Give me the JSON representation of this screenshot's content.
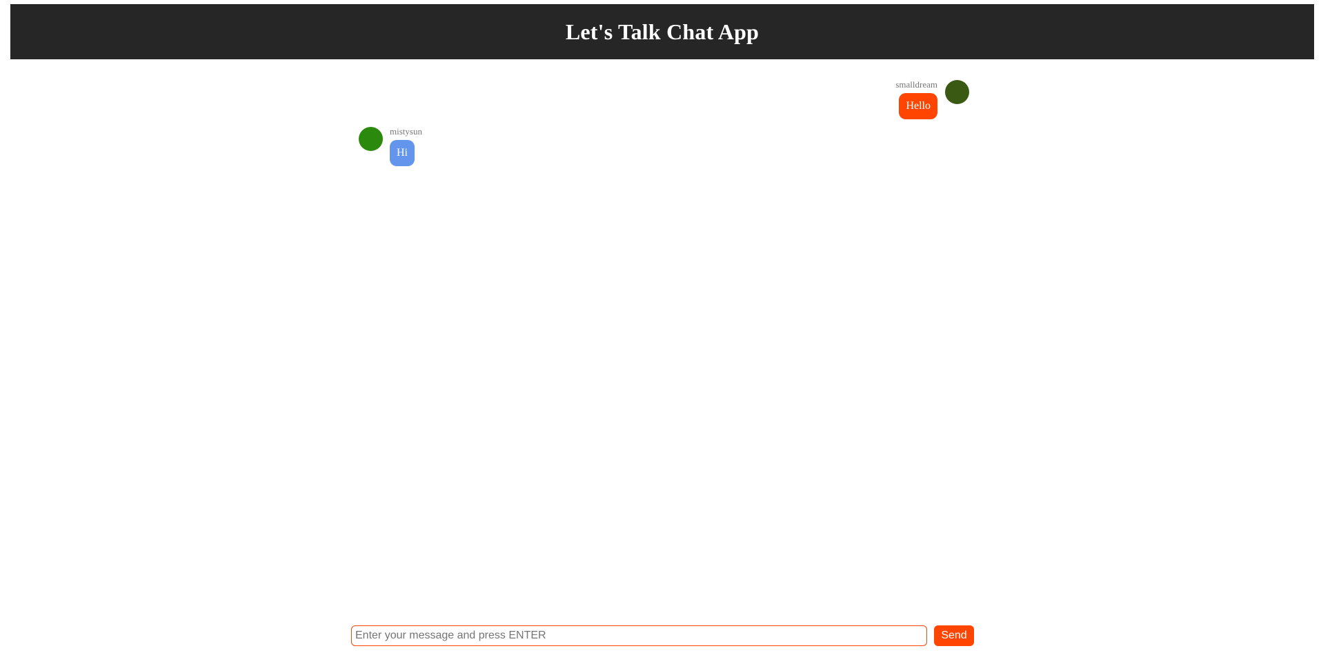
{
  "header": {
    "title": "Let's Talk Chat App"
  },
  "messages": [
    {
      "username": "smalldream",
      "text": "Hello",
      "side": "right",
      "avatar_color": "#3a5a13",
      "bubble_color": "#ff4500"
    },
    {
      "username": "mistysun",
      "text": "Hi",
      "side": "left",
      "avatar_color": "#2b8a0d",
      "bubble_color": "#6495ed"
    }
  ],
  "composer": {
    "placeholder": "Enter your message and press ENTER",
    "value": "",
    "send_label": "Send",
    "accent_color": "#ff4500"
  },
  "colors": {
    "header_bg": "#262626",
    "page_bg": "#ffffff",
    "username_text": "#777777"
  }
}
